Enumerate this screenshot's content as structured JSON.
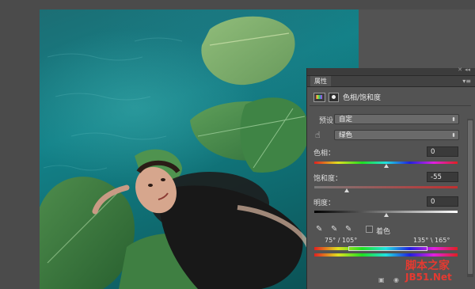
{
  "panel": {
    "tab_label": "属性",
    "adjustment_title": "色相/饱和度",
    "preset_label": "预设：",
    "preset_value": "自定",
    "channel_value": "绿色",
    "hue_label": "色相：",
    "hue_value": "0",
    "saturation_label": "饱和度：",
    "saturation_value": "-55",
    "lightness_label": "明度：",
    "lightness_value": "0",
    "colorize_label": "着色",
    "range_left": "75° / 105°",
    "range_right": "135° \\ 165°"
  },
  "sliders": {
    "hue_position": 0.5,
    "saturation_position": 0.225,
    "lightness_position": 0.5
  },
  "watermark": {
    "line1": "脚本之家",
    "line2": "JB51.Net"
  },
  "icons": [
    "hand-icon",
    "eyedropper-icon",
    "eyedropper-plus-icon",
    "eyedropper-minus-icon",
    "menu-icon"
  ],
  "colors": {
    "panel_bg": "#535353",
    "water": "#138289",
    "watermark": "#e43a31"
  }
}
